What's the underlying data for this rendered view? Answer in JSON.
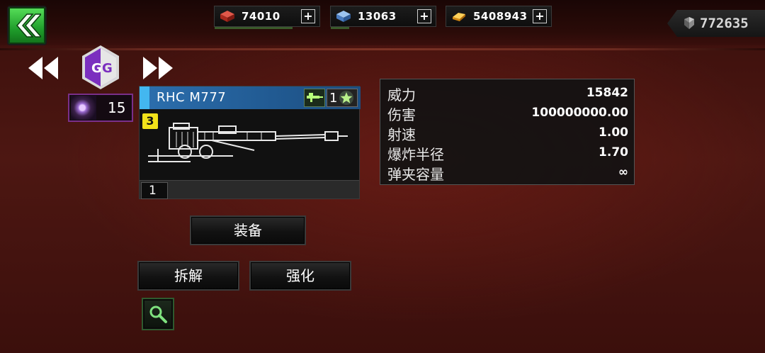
{
  "resources": [
    {
      "name": "bricks",
      "value": "74010",
      "icon": "brick-icon",
      "color": "#c0392b",
      "fill": 0.6
    },
    {
      "name": "steel",
      "value": "13063",
      "icon": "steel-crate-icon",
      "color": "#5b8fd6",
      "fill": 0.15
    },
    {
      "name": "gold",
      "value": "5408943",
      "icon": "gold-bar-icon",
      "color": "#f0a020",
      "fill": 0.0
    }
  ],
  "gems": {
    "value": "772635",
    "icon": "gem-icon"
  },
  "selected_unit": {
    "count": "15"
  },
  "weapon": {
    "name": "RHC M777",
    "stars": "1",
    "level": "3",
    "count": "1",
    "rarity_color": "#43b7f0"
  },
  "stats": [
    {
      "label": "威力",
      "value": "15842"
    },
    {
      "label": "伤害",
      "value": "100000000.00"
    },
    {
      "label": "射速",
      "value": "1.00"
    },
    {
      "label": "爆炸半径",
      "value": "1.70"
    },
    {
      "label": "弹夹容量",
      "value": "∞"
    }
  ],
  "actions": {
    "equip": "装备",
    "dismantle": "拆解",
    "upgrade": "强化"
  }
}
